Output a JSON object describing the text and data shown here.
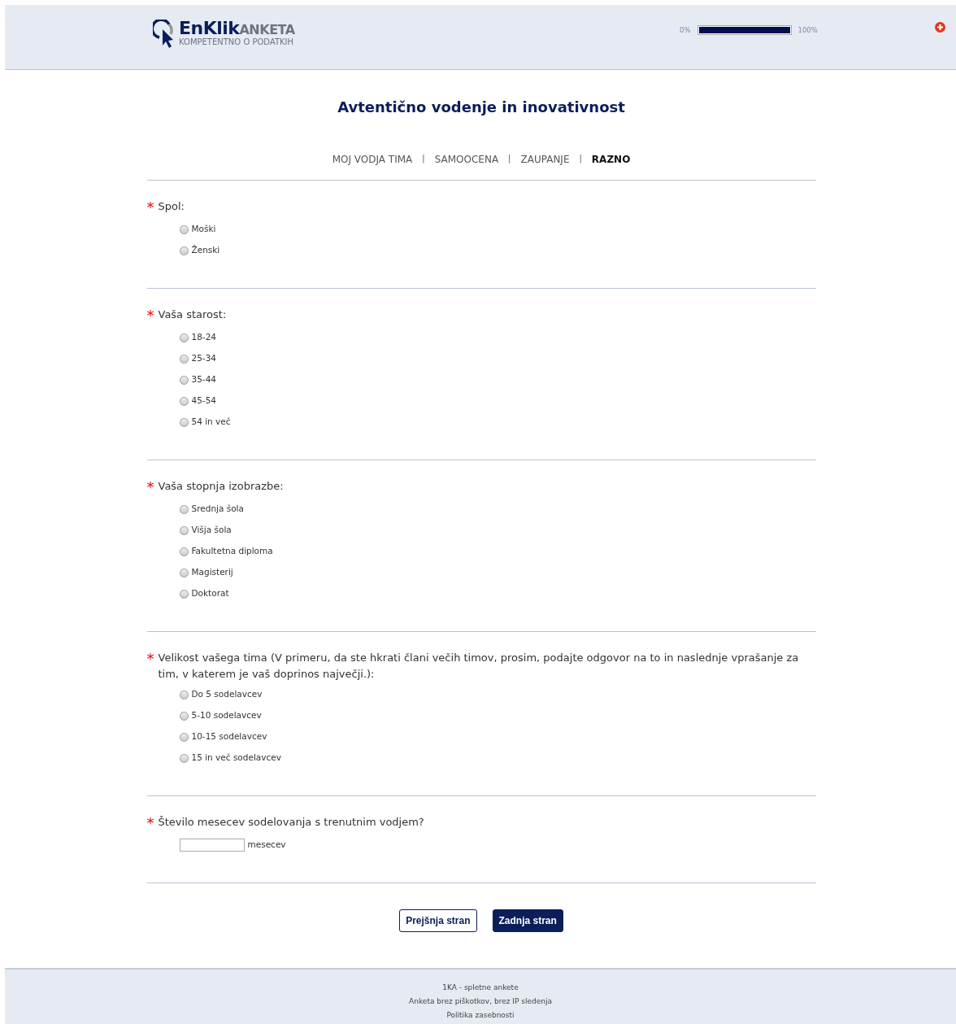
{
  "header": {
    "logo": {
      "brand": "EnKlik",
      "brand_suffix": "ANKETA",
      "tagline": "KOMPETENTNO O PODATKIH"
    },
    "progress": {
      "start_label": "0%",
      "end_label": "100%",
      "level": 1
    }
  },
  "title": "Avtentično vodenje in inovativnost",
  "nav": [
    {
      "label": "MOJ VODJA TIMA",
      "selected": false
    },
    {
      "label": "SAMOOCENA",
      "selected": false
    },
    {
      "label": "ZAUPANJE",
      "selected": false
    },
    {
      "label": "RAZNO",
      "selected": true
    }
  ],
  "nav_separator": "|",
  "questions": [
    {
      "kind": "radio",
      "required_mark": "*",
      "text": "Spol:",
      "options": [
        {
          "label": "Moški",
          "selected": false
        },
        {
          "label": "Ženski",
          "selected": false
        }
      ]
    },
    {
      "kind": "radio",
      "required_mark": "*",
      "text": "Vaša starost:",
      "options": [
        {
          "label": "18-24",
          "selected": false
        },
        {
          "label": "25-34",
          "selected": false
        },
        {
          "label": "35-44",
          "selected": false
        },
        {
          "label": "45-54",
          "selected": false
        },
        {
          "label": "54 in več",
          "selected": false
        }
      ]
    },
    {
      "kind": "radio",
      "required_mark": "*",
      "text": "Vaša stopnja izobrazbe:",
      "options": [
        {
          "label": "Srednja šola",
          "selected": false
        },
        {
          "label": "Višja šola",
          "selected": false
        },
        {
          "label": "Fakultetna diploma",
          "selected": false
        },
        {
          "label": "Magisterij",
          "selected": false
        },
        {
          "label": "Doktorat",
          "selected": false
        }
      ]
    },
    {
      "kind": "radio",
      "required_mark": "*",
      "text": "Velikost vašega tima (V primeru, da ste hkrati člani večih timov, prosim, podajte odgovor na to in naslednje vprašanje za tim, v katerem je vaš doprinos največji.):",
      "options": [
        {
          "label": "Do 5 sodelavcev",
          "selected": false
        },
        {
          "label": "5-10 sodelavcev",
          "selected": false
        },
        {
          "label": "10-15 sodelavcev",
          "selected": false
        },
        {
          "label": "15 in več sodelavcev",
          "selected": false
        }
      ]
    },
    {
      "kind": "number",
      "required_mark": "*",
      "text": "Število mesecev sodelovanja s trenutnim vodjem?",
      "unit": "mesecev"
    }
  ],
  "buttons": [
    {
      "label": "Prejšnja stran",
      "kind": "secondary"
    },
    {
      "label": "Zadnja stran",
      "kind": "primary"
    }
  ],
  "footer": [
    "1KA - spletne ankete",
    "Anketa brez piškotkov, brez IP sledenja",
    "Politika zasebnosti"
  ]
}
